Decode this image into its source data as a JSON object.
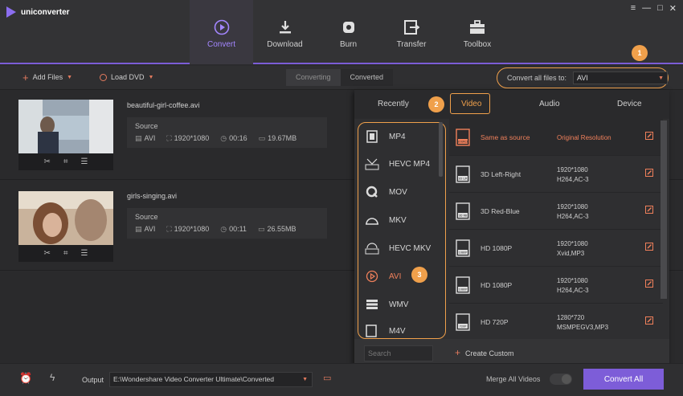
{
  "app": {
    "title": "uniconverter",
    "win_controls": [
      "≡",
      "—",
      "□",
      "✕"
    ]
  },
  "nav": [
    {
      "label": "Convert",
      "icon": "convert-icon"
    },
    {
      "label": "Download",
      "icon": "download-icon"
    },
    {
      "label": "Burn",
      "icon": "burn-icon"
    },
    {
      "label": "Transfer",
      "icon": "transfer-icon"
    },
    {
      "label": "Toolbox",
      "icon": "toolbox-icon"
    }
  ],
  "toolbar": {
    "add_files": "Add Files",
    "load_dvd": "Load DVD",
    "tab_converting": "Converting",
    "tab_converted": "Converted",
    "convert_all_label": "Convert all files to:",
    "convert_all_value": "AVI"
  },
  "files": [
    {
      "name": "beautiful-girl-coffee.avi",
      "source_label": "Source",
      "format": "AVI",
      "resolution": "1920*1080",
      "duration": "00:16",
      "size": "19.67MB"
    },
    {
      "name": "girls-singing.avi",
      "source_label": "Source",
      "format": "AVI",
      "resolution": "1920*1080",
      "duration": "00:11",
      "size": "26.55MB"
    }
  ],
  "panel": {
    "tabs": [
      "Recently",
      "Video",
      "Audio",
      "Device"
    ],
    "active_tab": "Video",
    "formats": [
      "MP4",
      "HEVC MP4",
      "MOV",
      "MKV",
      "HEVC MKV",
      "AVI",
      "WMV",
      "M4V"
    ],
    "active_format": "AVI",
    "options": [
      {
        "icon_text": "SOURCE",
        "name": "Same as source",
        "res1": "Original Resolution",
        "res2": ""
      },
      {
        "icon_text": "3D L/R",
        "name": "3D Left-Right",
        "res1": "1920*1080",
        "res2": "H264,AC-3"
      },
      {
        "icon_text": "3D RB",
        "name": "3D Red-Blue",
        "res1": "1920*1080",
        "res2": "H264,AC-3"
      },
      {
        "icon_text": "1080P",
        "name": "HD 1080P",
        "res1": "1920*1080",
        "res2": "Xvid,MP3"
      },
      {
        "icon_text": "1080P",
        "name": "HD 1080P",
        "res1": "1920*1080",
        "res2": "H264,AC-3"
      },
      {
        "icon_text": "720P",
        "name": "HD 720P",
        "res1": "1280*720",
        "res2": "MSMPEGV3,MP3"
      }
    ],
    "search_placeholder": "Search",
    "create_custom": "Create Custom"
  },
  "badges": [
    "1",
    "2",
    "3"
  ],
  "bottom": {
    "output_label": "Output",
    "output_path": "E:\\Wondershare Video Converter Ultimate\\Converted",
    "merge_label": "Merge All Videos",
    "merge_on": false,
    "convert_all": "Convert All"
  },
  "colors": {
    "accent": "#7d5dd8",
    "highlight": "#f0a04b",
    "active_text": "#f0805b"
  }
}
